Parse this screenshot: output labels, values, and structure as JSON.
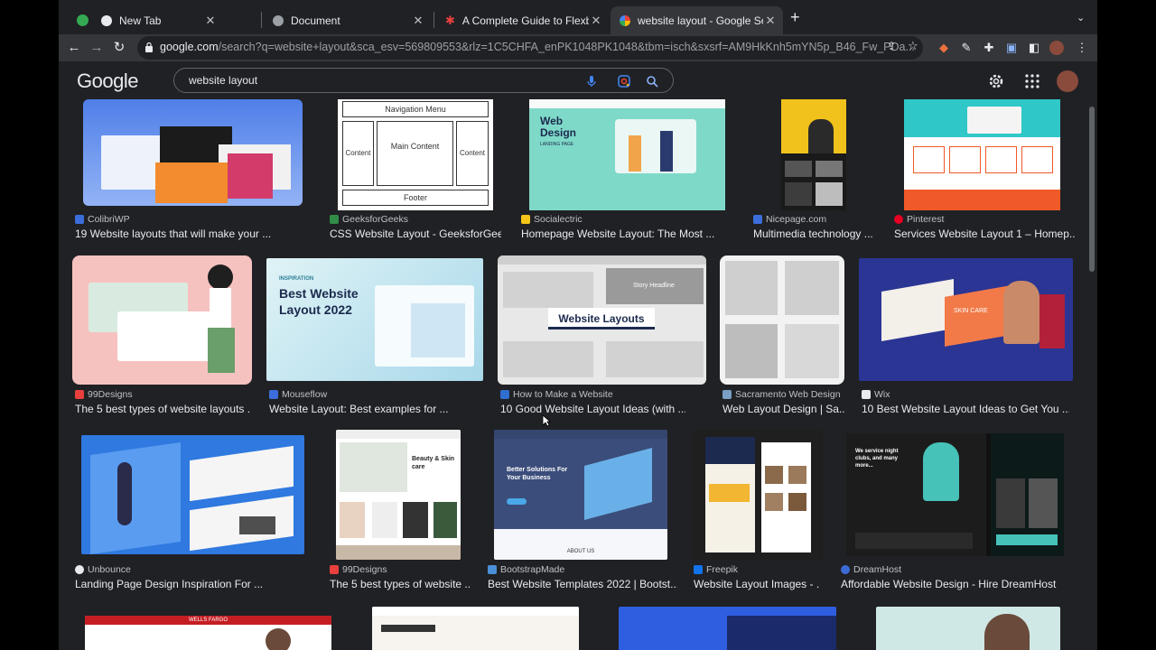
{
  "tabs": [
    {
      "label": "New Tab",
      "favicon_color": "#e8eaed"
    },
    {
      "label": "Document",
      "favicon_color": "#9aa0a6"
    },
    {
      "label": "A Complete Guide to Flexbox | CSS-Tricks",
      "favicon_color": "#e8413d"
    },
    {
      "label": "website layout - Google Search",
      "favicon_color": "#4285f4"
    }
  ],
  "omnibox": {
    "domain": "google.com",
    "path": "/search?q=website+layout&sca_esv=569809553&rlz=1C5CHFA_enPK1048PK1048&tbm=isch&sxsrf=AM9HkKnh5mYN5p_B46_Fw_PDa..."
  },
  "google": {
    "logo": "Google",
    "query": "website layout"
  },
  "results": [
    {
      "source": "ColibriWP",
      "title": "19 Website layouts that will make your ...",
      "fav": "#3b6edb"
    },
    {
      "source": "GeeksforGeeks",
      "title": "CSS Website Layout - GeeksforGee...",
      "fav": "#2f8d46"
    },
    {
      "source": "Socialectric",
      "title": "Homepage Website Layout: The Most ...",
      "fav": "#f5c518"
    },
    {
      "source": "Nicepage.com",
      "title": "Multimedia technology ...",
      "fav": "#3b6edb"
    },
    {
      "source": "Pinterest",
      "title": "Services Website Layout 1 – Homep...",
      "fav": "#e60023"
    },
    {
      "source": "99Designs",
      "title": "The 5 best types of website layouts ...",
      "fav": "#e8413d"
    },
    {
      "source": "Mouseflow",
      "title": "Website Layout: Best examples for ...",
      "fav": "#3b6edb"
    },
    {
      "source": "How to Make a Website",
      "title": "10 Good Website Layout Ideas (with ...",
      "fav": "#2f6fd0"
    },
    {
      "source": "Sacramento Web Design",
      "title": "Web Layout Design | Sa...",
      "fav": "#7aa0c4"
    },
    {
      "source": "Wix",
      "title": "10 Best Website Layout Ideas to Get You ...",
      "fav": "#e8eaed"
    },
    {
      "source": "Unbounce",
      "title": "Landing Page Design Inspiration For ...",
      "fav": "#e8eaed"
    },
    {
      "source": "99Designs",
      "title": "The 5 best types of website ...",
      "fav": "#e8413d"
    },
    {
      "source": "BootstrapMade",
      "title": "Best Website Templates 2022 | Bootst...",
      "fav": "#4a90d9"
    },
    {
      "source": "Freepik",
      "title": "Website Layout Images - ...",
      "fav": "#1273eb"
    },
    {
      "source": "DreamHost",
      "title": "Affordable Website Design - Hire DreamHost",
      "fav": "#3c6bd6"
    }
  ],
  "thumb_text": {
    "gfg_nav": "Navigation Menu",
    "gfg_content": "Content",
    "gfg_main": "Main Content",
    "gfg_footer": "Footer",
    "web_design": "Web Design",
    "landing_page": "LANDING PAGE",
    "inspiration": "INSPIRATION",
    "best_website_layout": "Best Website Layout 2022",
    "story_headline": "Story Headline",
    "website_layouts": "Website Layouts",
    "skin_care": "SKIN CARE",
    "beauty": "Beauty & Skin care",
    "better_solutions": "Better Solutions For Your Business",
    "about_us": "ABOUT US",
    "we_service": "We service night clubs, and many more...",
    "wells_fargo": "WELLS FARGO"
  }
}
